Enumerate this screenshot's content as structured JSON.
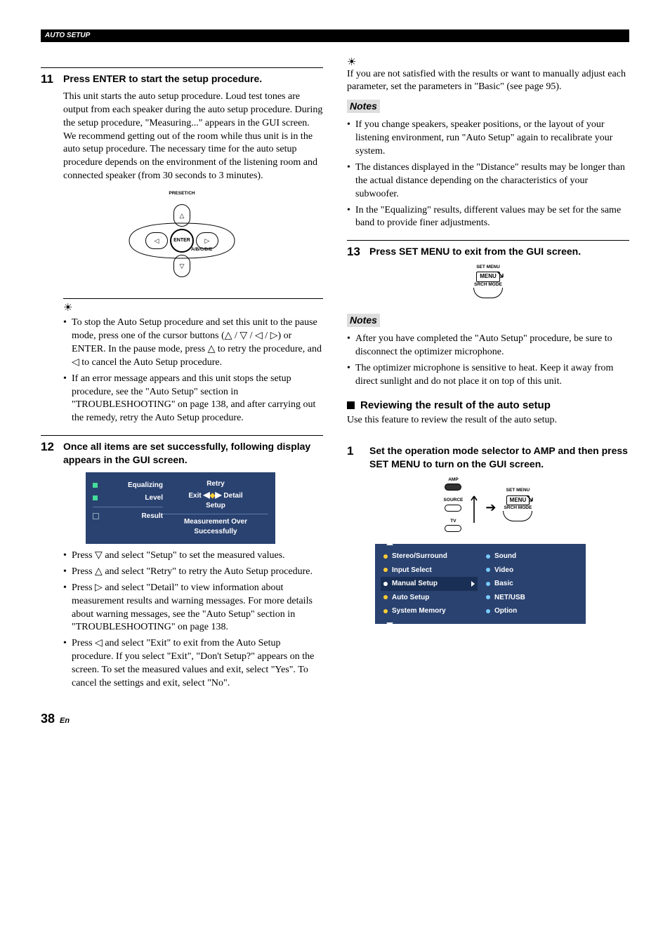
{
  "header": "AUTO SETUP",
  "step11": {
    "num": "11",
    "title": "Press ENTER to start the setup procedure.",
    "body": "This unit starts the auto setup procedure. Loud test tones are output from each speaker during the auto setup procedure. During the setup procedure, \"Measuring...\" appears in the GUI screen. We recommend getting out of the room while thus unit is in the auto setup procedure. The necessary time for the auto setup procedure depends on the environment of the listening room and connected speaker (from 30 seconds to 3 minutes).",
    "pad": {
      "top": "PRESET/CH",
      "bottom": "A/B/C/D/E",
      "center": "ENTER"
    },
    "tips": [
      "To stop the Auto Setup procedure and set this unit to the pause mode, press one of the cursor buttons (△ / ▽ / ◁ / ▷) or ENTER. In the pause mode, press △ to retry the procedure, and ◁ to cancel the Auto Setup procedure.",
      "If an error message appears and this unit stops the setup procedure, see the \"Auto Setup\" section in \"TROUBLESHOOTING\" on page 138, and after carrying out the remedy, retry the Auto Setup procedure."
    ]
  },
  "step12": {
    "num": "12",
    "title": "Once all items are set successfully, following display appears in the GUI screen.",
    "gui_left": [
      "Equalizing",
      "Level",
      "Result"
    ],
    "gui_retry": "Retry",
    "gui_exit": "Exit",
    "gui_detail": "Detail",
    "gui_setup": "Setup",
    "gui_msg1": "Measurement Over",
    "gui_msg2": "Successfully",
    "bullets": [
      "Press ▽ and select \"Setup\" to set the measured values.",
      "Press △ and select \"Retry\" to retry the Auto Setup procedure.",
      "Press ▷ and select \"Detail\" to view information about measurement results and warning messages. For more details about warning messages, see the \"Auto Setup\" section in \"TROUBLESHOOTING\" on page 138.",
      "Press ◁ and select \"Exit\" to exit from the Auto Setup procedure. If you select \"Exit\", \"Don't Setup?\" appears on the screen. To set the measured values and exit, select \"Yes\". To cancel the settings and exit, select \"No\"."
    ]
  },
  "rcol_tip": "If you are not satisfied with the results or want to manually adjust each parameter, set the parameters in \"Basic\" (see page 95).",
  "notes_label": "Notes",
  "notes1": [
    "If you change speakers, speaker positions, or the layout of your listening environment, run \"Auto Setup\" again to recalibrate your system.",
    "The distances displayed in the \"Distance\" results may be longer than the actual distance depending on the characteristics of your subwoofer.",
    "In the \"Equalizing\" results, different values may be set for the same band to provide finer adjustments."
  ],
  "step13": {
    "num": "13",
    "title": "Press SET MENU to exit from the GUI screen.",
    "key_top": "SET MENU",
    "key_mid": "MENU",
    "key_bot": "SRCH MODE"
  },
  "notes2": [
    "After you have completed the \"Auto Setup\" procedure, be sure to disconnect the optimizer microphone.",
    "The optimizer microphone is sensitive to heat. Keep it away from direct sunlight and do not place it on top of this unit."
  ],
  "review": {
    "heading": "Reviewing the result of the auto setup",
    "intro": "Use this feature to review the result of the auto setup."
  },
  "step1": {
    "num": "1",
    "title": "Set the operation mode selector to AMP and then press SET MENU to turn on the GUI screen.",
    "mode": {
      "amp": "AMP",
      "source": "SOURCE",
      "tv": "TV",
      "set": "SET MENU",
      "menu": "MENU",
      "srch": "SRCH MODE"
    },
    "menu_left": [
      "Stereo/Surround",
      "Input Select",
      "Manual Setup",
      "Auto Setup",
      "System Memory"
    ],
    "menu_left_sel": 2,
    "menu_right": [
      "Sound",
      "Video",
      "Basic",
      "NET/USB",
      "Option"
    ]
  },
  "page": {
    "num": "38",
    "suffix": "En"
  }
}
